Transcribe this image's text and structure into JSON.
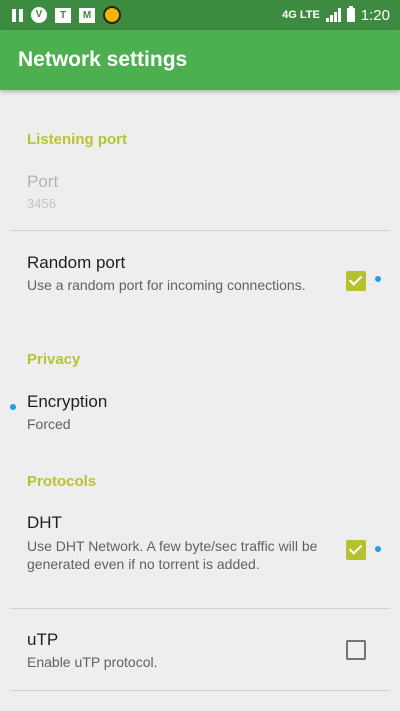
{
  "status_bar": {
    "time": "1:20",
    "network": "4G LTE",
    "icons": [
      "pause-icon",
      "shield-icon",
      "tt-icon",
      "mail-icon",
      "flame-icon",
      "signal-icon",
      "battery-icon"
    ]
  },
  "app_bar": {
    "title": "Network settings"
  },
  "sections": {
    "listening_port": {
      "header": "Listening port",
      "port": {
        "title": "Port",
        "value": "3456"
      }
    },
    "random_port": {
      "title": "Random port",
      "summary": "Use a random port for incoming connections.",
      "checked": true
    },
    "privacy": {
      "header": "Privacy",
      "encryption": {
        "title": "Encryption",
        "value": "Forced"
      }
    },
    "protocols": {
      "header": "Protocols",
      "dht": {
        "title": "DHT",
        "summary": "Use DHT Network. A few byte/sec traffic will be generated even if no torrent is added.",
        "checked": true
      },
      "utp": {
        "title": "uTP",
        "summary": "Enable uTP protocol.",
        "checked": false
      }
    }
  },
  "colors": {
    "status_bar": "#3d8b40",
    "app_bar": "#4caf50",
    "accent": "#b5c22f",
    "background": "#eeeeee",
    "indicator_dot": "#1aa1e6"
  }
}
